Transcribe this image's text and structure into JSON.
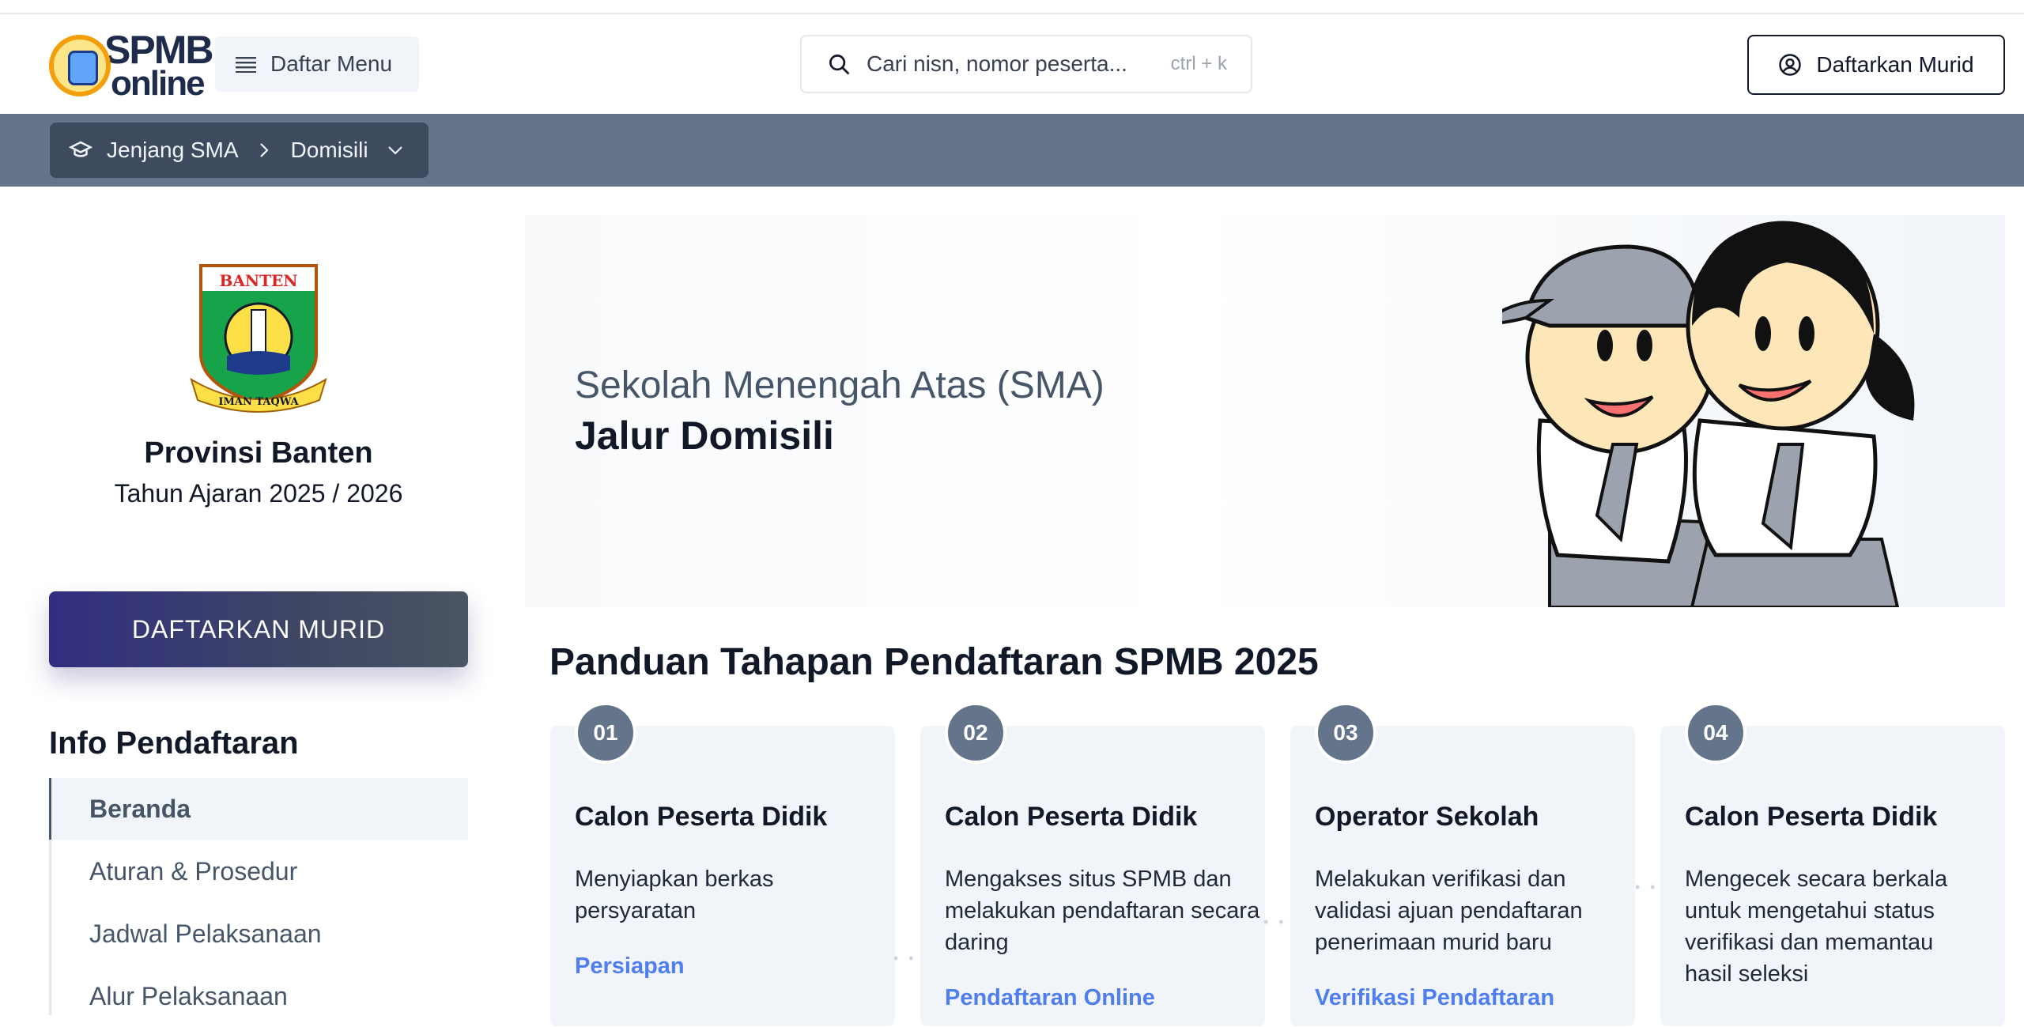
{
  "header": {
    "logo_line1": "SPMB",
    "logo_line2": "online",
    "menu_label": "Daftar Menu",
    "search_placeholder": "Cari nisn, nomor peserta...",
    "search_shortcut": "ctrl + k",
    "register_label": "Daftarkan Murid"
  },
  "breadcrumb": {
    "level": "Jenjang SMA",
    "path": "Domisili"
  },
  "sidebar": {
    "province_emblem_text_top": "BANTEN",
    "province_emblem_text_bottom": "IMAN TAQWA",
    "province": "Provinsi Banten",
    "year": "Tahun Ajaran 2025 / 2026",
    "cta_label": "DAFTARKAN MURID",
    "info_title": "Info Pendaftaran",
    "nav": [
      {
        "label": "Beranda",
        "active": true
      },
      {
        "label": "Aturan & Prosedur",
        "active": false
      },
      {
        "label": "Jadwal Pelaksanaan",
        "active": false
      },
      {
        "label": "Alur Pelaksanaan",
        "active": false
      }
    ]
  },
  "hero": {
    "subtitle": "Sekolah Menengah Atas (SMA)",
    "title": "Jalur Domisili"
  },
  "guide": {
    "title": "Panduan Tahapan Pendaftaran SPMB 2025",
    "steps": [
      {
        "num": "01",
        "who": "Calon Peserta Didik",
        "desc": "Menyiapkan berkas persyaratan",
        "tag": "Persiapan"
      },
      {
        "num": "02",
        "who": "Calon Peserta Didik",
        "desc": "Mengakses situs SPMB dan melakukan pendaftaran secara daring",
        "tag": "Pendaftaran Online"
      },
      {
        "num": "03",
        "who": "Operator Sekolah",
        "desc": "Melakukan verifikasi dan validasi ajuan pendaftaran penerimaan murid baru",
        "tag": "Verifikasi Pendaftaran"
      },
      {
        "num": "04",
        "who": "Calon Peserta Didik",
        "desc": "Mengecek secara berkala untuk mengetahui status verifikasi dan memantau hasil seleksi",
        "tag": ""
      }
    ]
  },
  "colors": {
    "breadcrumb_bar": "#64748b",
    "breadcrumb_box": "#3e4a5e",
    "cta_start": "#312e81",
    "step_tag": "#4f7ef0"
  }
}
